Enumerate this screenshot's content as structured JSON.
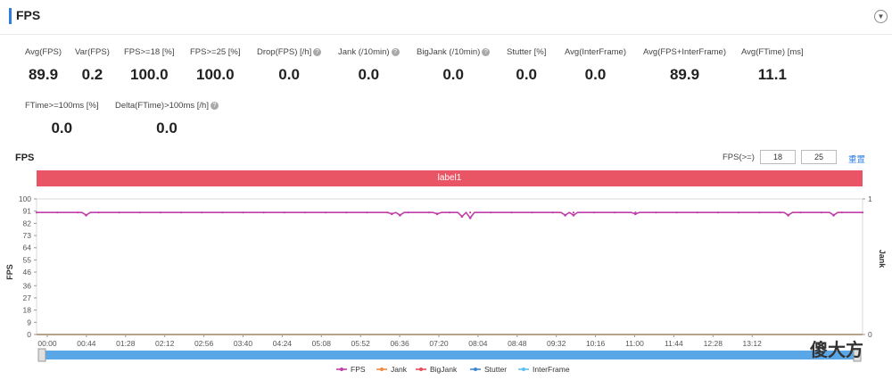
{
  "header": {
    "title": "FPS",
    "collapse_icon": "chevron-down-icon"
  },
  "metrics_row1": [
    {
      "label": "Avg(FPS)",
      "value": "89.9",
      "help": false
    },
    {
      "label": "Var(FPS)",
      "value": "0.2",
      "help": false
    },
    {
      "label": "FPS>=18 [%]",
      "value": "100.0",
      "help": false
    },
    {
      "label": "FPS>=25 [%]",
      "value": "100.0",
      "help": false
    },
    {
      "label": "Drop(FPS) [/h]",
      "value": "0.0",
      "help": true
    },
    {
      "label": "Jank (/10min)",
      "value": "0.0",
      "help": true
    },
    {
      "label": "BigJank (/10min)",
      "value": "0.0",
      "help": true
    },
    {
      "label": "Stutter [%]",
      "value": "0.0",
      "help": false
    },
    {
      "label": "Avg(InterFrame)",
      "value": "0.0",
      "help": false
    },
    {
      "label": "Avg(FPS+InterFrame)",
      "value": "89.9",
      "help": false
    },
    {
      "label": "Avg(FTime) [ms]",
      "value": "11.1",
      "help": false
    }
  ],
  "metrics_row2": [
    {
      "label": "FTime>=100ms [%]",
      "value": "0.0",
      "help": false
    },
    {
      "label": "Delta(FTime)>100ms [/h]",
      "value": "0.0",
      "help": true
    }
  ],
  "chart_section": {
    "title": "FPS",
    "threshold_label": "FPS(>=)",
    "threshold_low": "18",
    "threshold_high": "25",
    "reset_link": "重置",
    "banner_label": "label1"
  },
  "chart_data": {
    "type": "line",
    "ylabel": "FPS",
    "y2label": "Jank",
    "ylim": [
      0,
      100
    ],
    "y2lim": [
      0,
      1
    ],
    "yticks": [
      0,
      9,
      18,
      27,
      36,
      46,
      55,
      64,
      73,
      82,
      91,
      100
    ],
    "y2ticks": [
      0,
      1
    ],
    "xticks": [
      "00:00",
      "00:44",
      "01:28",
      "02:12",
      "02:56",
      "03:40",
      "04:24",
      "05:08",
      "05:52",
      "06:36",
      "07:20",
      "08:04",
      "08:48",
      "09:32",
      "10:16",
      "11:00",
      "11:44",
      "12:28",
      "13:12"
    ],
    "series": [
      {
        "name": "FPS",
        "color": "#c03fa8",
        "baseline": 90,
        "dips": [
          [
            0.06,
            88
          ],
          [
            0.64,
            88
          ],
          [
            0.515,
            87
          ],
          [
            0.525,
            86
          ],
          [
            0.485,
            89
          ],
          [
            0.43,
            89
          ],
          [
            0.44,
            88
          ],
          [
            0.725,
            89
          ],
          [
            0.965,
            88
          ],
          [
            0.91,
            88
          ],
          [
            0.65,
            88
          ]
        ]
      },
      {
        "name": "Jank",
        "color": "#f08a3e",
        "constant": 0
      },
      {
        "name": "BigJank",
        "color": "#e0505a",
        "constant": 0
      },
      {
        "name": "Stutter",
        "color": "#3f86d6",
        "constant": 0
      },
      {
        "name": "InterFrame",
        "color": "#5bc2ee",
        "constant": 0
      }
    ]
  },
  "watermark": "傻大方"
}
